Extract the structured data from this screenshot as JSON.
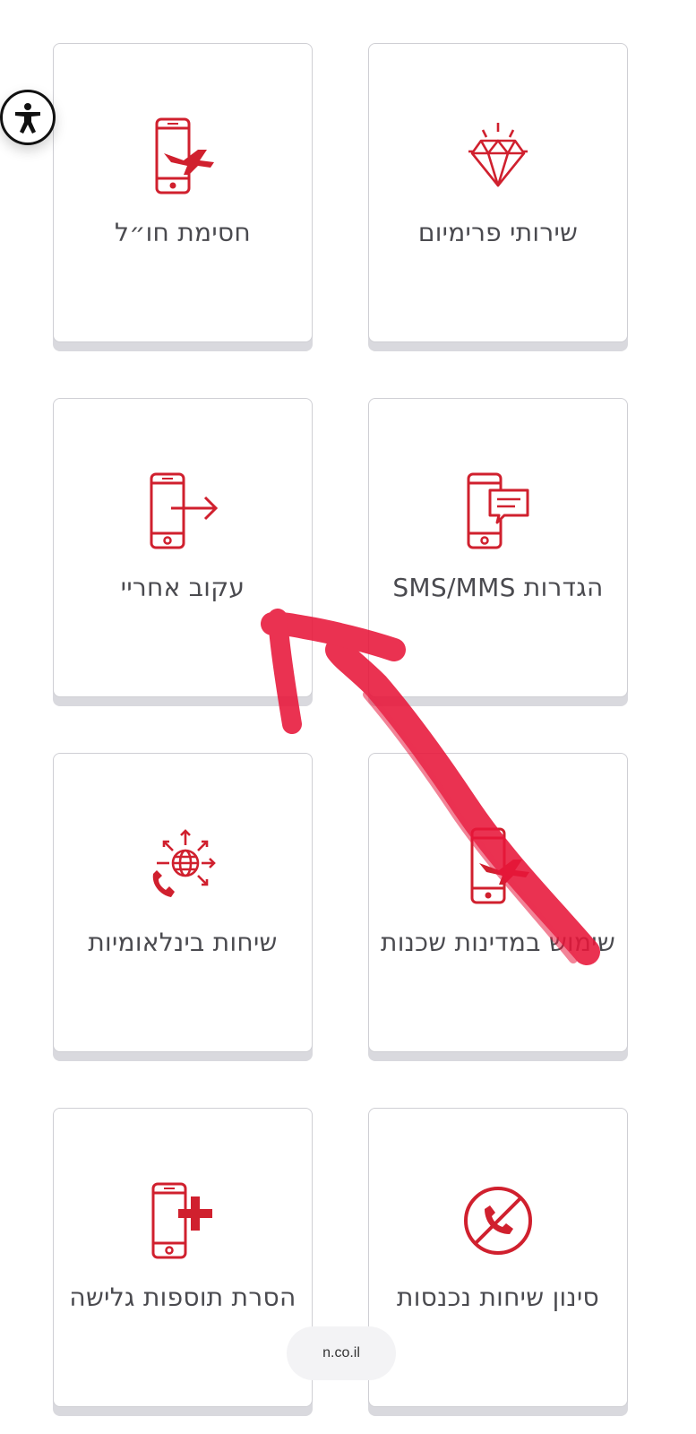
{
  "colors": {
    "accent": "#d0202e",
    "text": "#4a4a4f",
    "scribble": "#e8163a"
  },
  "accessibility": {
    "icon": "accessibility-icon"
  },
  "cards": [
    {
      "label": "שירותי פרימיום",
      "icon": "diamond-icon"
    },
    {
      "label": "חסימת חו״ל",
      "icon": "phone-plane-icon"
    },
    {
      "label": "הגדרות SMS/MMS",
      "icon": "phone-message-icon"
    },
    {
      "label": "עקוב אחריי",
      "icon": "phone-forward-icon"
    },
    {
      "label": "שימוש במדינות שכנות",
      "icon": "phone-plane-icon"
    },
    {
      "label": "שיחות בינלאומיות",
      "icon": "globe-call-icon"
    },
    {
      "label": "סינון שיחות נכנסות",
      "icon": "call-block-icon"
    },
    {
      "label": "הסרת תוספות גלישה",
      "icon": "phone-plus-icon"
    }
  ],
  "url_pill": {
    "text": "n.co.il"
  },
  "annotation": {
    "icon": "hand-drawn-arrow-icon"
  }
}
